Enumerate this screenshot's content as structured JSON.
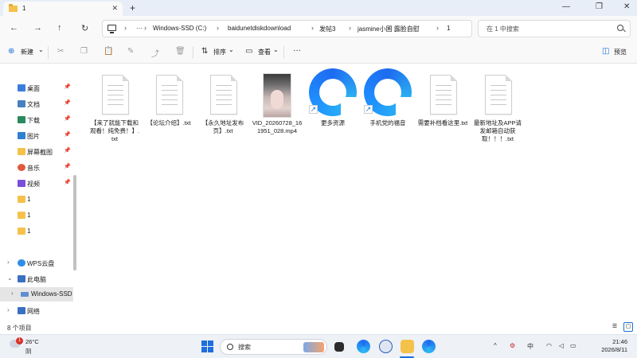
{
  "window": {
    "tab_title": "1",
    "tab_close": "✕",
    "new_tab": "+",
    "controls": [
      "—",
      "❐",
      "✕"
    ]
  },
  "nav": {
    "back": "←",
    "forward": "→",
    "up": "↑",
    "refresh": "↻",
    "more": "···",
    "breadcrumbs": [
      "Windows-SSD (C:)",
      "baidunetdiskdownload",
      "发帖3",
      "jasmine小囷 露脸自慰",
      "1"
    ],
    "search_placeholder": "在 1 中搜索"
  },
  "commands": {
    "new": "新建",
    "new_arrow": "⌄",
    "sort": "排序",
    "view": "查看",
    "more": "···",
    "preview": "预览"
  },
  "sidebar": {
    "items": [
      {
        "label": "桌面",
        "color": "#3b7ddd",
        "pinned": true
      },
      {
        "label": "文档",
        "color": "#4a7fc1",
        "pinned": true
      },
      {
        "label": "下载",
        "color": "#2a8a5e",
        "pinned": true
      },
      {
        "label": "图片",
        "color": "#2f7fd1",
        "pinned": true
      },
      {
        "label": "屏幕截图",
        "color": "#f4c24b",
        "pinned": true
      },
      {
        "label": "音乐",
        "color": "#e05a3f",
        "pinned": true
      },
      {
        "label": "视频",
        "color": "#7a4ed8",
        "pinned": true
      },
      {
        "label": "1",
        "color": "#f4c24b",
        "pinned": false
      },
      {
        "label": "1",
        "color": "#f4c24b",
        "pinned": false
      },
      {
        "label": "1",
        "color": "#f4c24b",
        "pinned": false
      },
      {
        "label": "WPS云盘",
        "color": "#2f8fe8",
        "pinned": false,
        "expander": "›"
      },
      {
        "label": "此电脑",
        "color": "#3a6fc4",
        "pinned": false,
        "expander": "⌄"
      },
      {
        "label": "Windows-SSD",
        "color": "#5f8fd0",
        "pinned": false,
        "expander": "›",
        "selected": true
      },
      {
        "label": "网络",
        "color": "#3a6fc4",
        "pinned": false,
        "expander": "›"
      }
    ],
    "pin_glyph": "📌"
  },
  "files": [
    {
      "name": "【来了就能下载和观看！纯免费！】.txt",
      "kind": "doc"
    },
    {
      "name": "【论坛介绍】.txt",
      "kind": "doc"
    },
    {
      "name": "【永久地址发布页】.txt",
      "kind": "doc"
    },
    {
      "name": "VID_20260728_161951_028.mp4",
      "kind": "video"
    },
    {
      "name": "更多资源",
      "kind": "shortcut"
    },
    {
      "name": "手机党的福音",
      "kind": "shortcut"
    },
    {
      "name": "需要补档看这里.txt",
      "kind": "doc"
    },
    {
      "name": "最新地址及APP请发邮箱自动获取！！！.txt",
      "kind": "doc"
    }
  ],
  "status": {
    "item_count": "8 个项目"
  },
  "taskbar": {
    "weather_badge": "1",
    "temperature": "26°C",
    "condition": "阴",
    "search_placeholder": "搜索",
    "tray_chevron": "^",
    "ime": "中",
    "time": "21:46",
    "date": "2026/8/11"
  },
  "colors": {
    "accent": "#1e6bf0",
    "folder": "#f4c24b",
    "sidebar_selected": "#e5e5e5"
  }
}
